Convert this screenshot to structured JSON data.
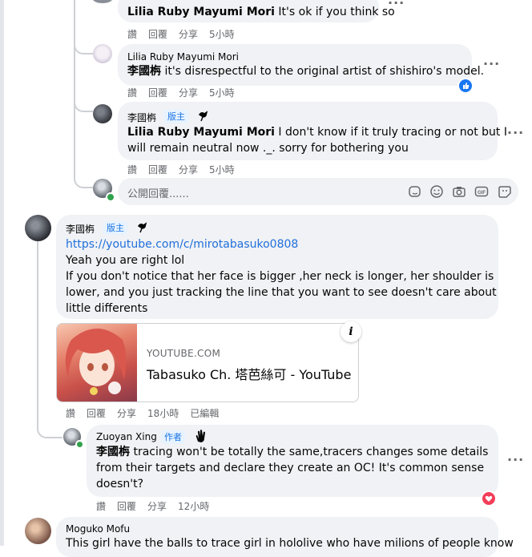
{
  "actions": {
    "like": "讚",
    "reply": "回覆",
    "share": "分享",
    "edited": "已編輯"
  },
  "comments": [
    {
      "name": "Lilia Ruby Mayumi Mori",
      "text": "It's ok if you think so",
      "time": "5小時"
    },
    {
      "name": "Lilia Ruby Mayumi Mori",
      "mention": "李國栴",
      "text": " it's disrespectful to the original artist of shishiro's model.",
      "time": "5小時",
      "reaction": "like"
    },
    {
      "name": "李國栴",
      "badge": "版主",
      "mention": "Lilia Ruby Mayumi Mori",
      "text_line1": " I don't know if it truly tracing or not but I",
      "text_line2": "will remain neutral now ._. sorry for bothering you",
      "time": "5小時"
    },
    {
      "name": "李國栴",
      "badge": "版主",
      "link": "https://youtube.com/c/mirotabasuko0808",
      "lines": [
        "Yeah you are right lol",
        "If you don't notice that her face is bigger ,her neck is longer, her shoulder is",
        "lower, and you just tracking the line that you want to see doesn't care about",
        "little differents"
      ],
      "time": "18小時",
      "card": {
        "domain": "YOUTUBE.COM",
        "title": "Tabasuko Ch. 塔芭絲可 - YouTube"
      }
    },
    {
      "name": "Zuoyan Xing",
      "badge": "作者",
      "mention": "李國栴",
      "text_line1": " tracing won't be totally the same,tracers changes some details",
      "line2": "from their targets and declare they create an OC! It's common sense",
      "line3": "doesn't?",
      "time": "12小時",
      "reaction": "love"
    },
    {
      "name": "Moguko Mofu",
      "text": "This girl have the balls to trace girl in hololive who have milions of people know"
    }
  ],
  "reply_box": {
    "placeholder": "公開回覆......"
  },
  "colors": {
    "bubble": "#f0f2f5",
    "link": "#216fdb",
    "badge_bg": "#e7f3ff",
    "badge_text": "#1b74e4",
    "meta": "#65676b",
    "like": "#1877f2",
    "love": "#f33e58"
  },
  "icons": [
    "more-options-icon",
    "sticker-icon",
    "emoji-icon",
    "camera-icon",
    "gif-icon",
    "avatar-sticker-icon",
    "info-icon",
    "like-reaction-icon",
    "love-reaction-icon",
    "top-fan-icon",
    "wave-icon"
  ]
}
